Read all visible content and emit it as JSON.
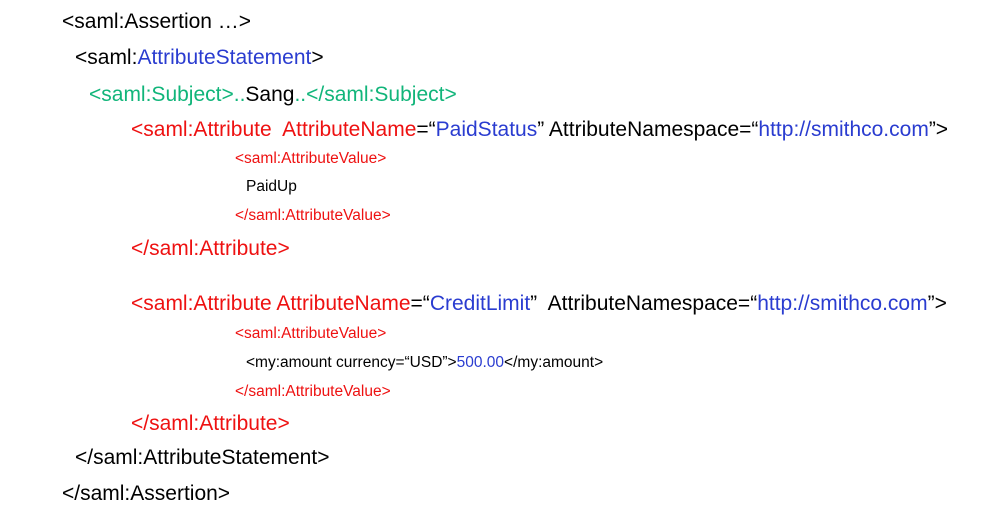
{
  "colors": {
    "text": "#000000",
    "element_blue": "#2a3cd0",
    "subject_green": "#11b57a",
    "attribute_red": "#ee1111"
  },
  "assertion": {
    "open": "<saml:Assertion …>",
    "close": "</saml:Assertion>"
  },
  "attribute_statement": {
    "open_prefix": "<saml:",
    "open_name": "AttributeStatement",
    "open_suffix": ">",
    "close": "</saml:AttributeStatement>"
  },
  "subject": {
    "open": "<saml:Subject>..",
    "value": "Sang",
    "close": "..</saml:Subject>"
  },
  "attribute1": {
    "open_tag": "<saml:Attribute  AttributeName",
    "eq1": "=“",
    "name": "PaidStatus",
    "mid": "” AttributeNamespace=“",
    "namespace": "http://smithco.com",
    "end": "”>",
    "value_open": "<saml:AttributeValue>",
    "value": "PaidUp",
    "value_close": "</saml:AttributeValue>",
    "close": "</saml:Attribute>"
  },
  "attribute2": {
    "open_tag": "<saml:Attribute AttributeName",
    "eq1": "=“",
    "name": "CreditLimit",
    "mid": "”  AttributeNamespace=“",
    "namespace": "http://smithco.com",
    "end": "”>",
    "value_open": "<saml:AttributeValue>",
    "amount_open": "<my:amount currency=“USD”>",
    "amount": "500.00",
    "amount_close": "</my:amount>",
    "value_close": "</saml:AttributeValue>",
    "close": "</saml:Attribute>"
  }
}
